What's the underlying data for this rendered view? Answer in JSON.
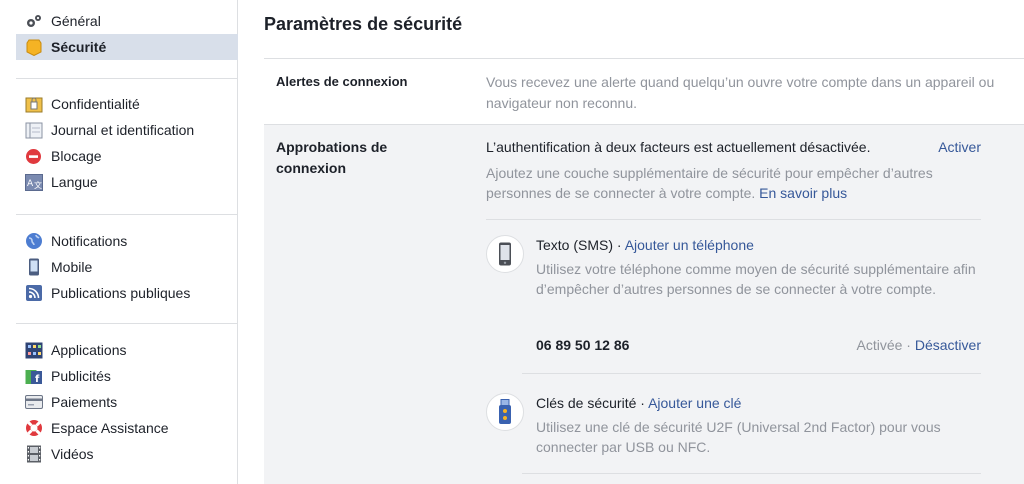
{
  "sidebar": {
    "groups": [
      [
        {
          "label": "Général",
          "icon": "gears-icon"
        },
        {
          "label": "Sécurité",
          "icon": "badge-icon",
          "active": true
        }
      ],
      [
        {
          "label": "Confidentialité",
          "icon": "lock-icon"
        },
        {
          "label": "Journal et identification",
          "icon": "journal-icon"
        },
        {
          "label": "Blocage",
          "icon": "block-icon"
        },
        {
          "label": "Langue",
          "icon": "language-icon"
        }
      ],
      [
        {
          "label": "Notifications",
          "icon": "globe-icon"
        },
        {
          "label": "Mobile",
          "icon": "mobile-icon"
        },
        {
          "label": "Publications publiques",
          "icon": "rss-icon"
        }
      ],
      [
        {
          "label": "Applications",
          "icon": "apps-icon"
        },
        {
          "label": "Publicités",
          "icon": "ads-icon"
        },
        {
          "label": "Paiements",
          "icon": "card-icon"
        },
        {
          "label": "Espace Assistance",
          "icon": "lifebuoy-icon"
        },
        {
          "label": "Vidéos",
          "icon": "film-icon"
        }
      ]
    ]
  },
  "main": {
    "title": "Paramètres de sécurité",
    "login_alerts": {
      "label": "Alertes de connexion",
      "description": "Vous recevez une alerte quand quelqu’un ouvre votre compte dans un appareil ou navigateur non reconnu."
    },
    "login_approvals": {
      "label": "Approbations de connexion",
      "status": "L’authentification à deux facteurs est actuellement désactivée.",
      "activate": "Activer",
      "info": "Ajoutez une couche supplémentaire de sécurité pour empêcher d’autres personnes de se connecter à votre compte.",
      "learn_more": "En savoir plus",
      "sms": {
        "title": "Texto (SMS)",
        "separator": " · ",
        "add_link": "Ajouter un téléphone",
        "description": "Utilisez votre téléphone comme moyen de sécurité supplémentaire afin d’empêcher d’autres personnes de se connecter à votre compte.",
        "phone": "06 89 50 12 86",
        "status": "Activée",
        "deactivate": "Désactiver"
      },
      "keys": {
        "title": "Clés de sécurité",
        "separator": " · ",
        "add_link": "Ajouter une clé",
        "description": "Utilisez une clé de sécurité U2F (Universal 2nd Factor) pour vous connecter par USB ou NFC."
      }
    }
  },
  "colors": {
    "link": "#365899",
    "muted": "#90949c",
    "active_bg": "#d8dfea",
    "section_bg": "#f2f3f5"
  }
}
